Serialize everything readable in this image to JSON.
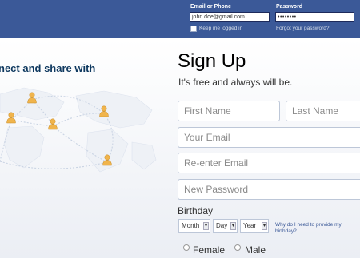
{
  "header": {
    "email_label": "Email or Phone",
    "password_label": "Password",
    "email_value": "john.doe@gmail.com",
    "password_value": "••••••••",
    "keep_logged_in": "Keep me logged in",
    "forgot_password": "Forgot your password?"
  },
  "promo": {
    "tagline": "nect and share with"
  },
  "signup": {
    "title": "Sign Up",
    "subtitle": "It's free and always will be.",
    "first_name_placeholder": "First Name",
    "last_name_placeholder": "Last Name",
    "email_placeholder": "Your Email",
    "reenter_email_placeholder": "Re-enter Email",
    "new_password_placeholder": "New Password",
    "birthday_label": "Birthday",
    "month_label": "Month",
    "day_label": "Day",
    "year_label": "Year",
    "why_birthday": "Why do I need to provide my birthday?",
    "female_label": "Female",
    "male_label": "Male"
  },
  "colors": {
    "brand_blue": "#3b5998",
    "title_navy": "#0e385f"
  },
  "icons": {
    "map_people": "person-icon",
    "dropdown": "chevron-down-icon"
  }
}
